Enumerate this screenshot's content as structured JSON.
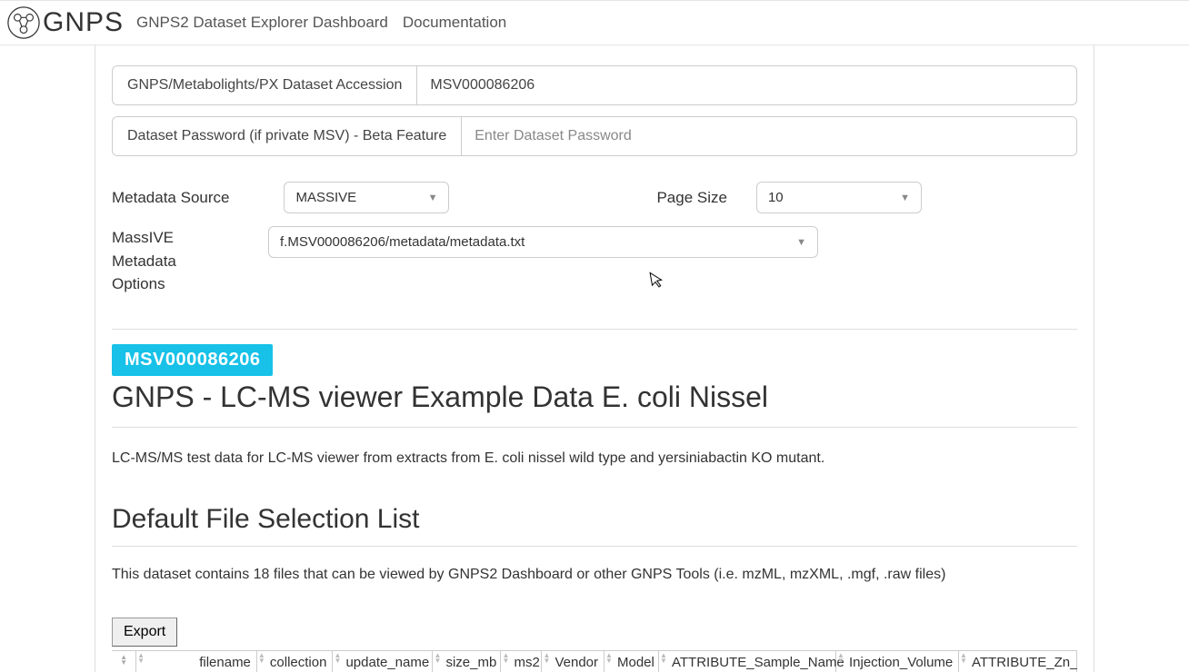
{
  "nav": {
    "logo_text": "GNPS",
    "link1": "GNPS2 Dataset Explorer Dashboard",
    "link2": "Documentation"
  },
  "form": {
    "accession_label": "GNPS/Metabolights/PX Dataset Accession",
    "accession_value": "MSV000086206",
    "password_label": "Dataset Password (if private MSV) - Beta Feature",
    "password_placeholder": "Enter Dataset Password",
    "metadata_source_label": "Metadata Source",
    "metadata_source_value": "MASSIVE",
    "page_size_label": "Page Size",
    "page_size_value": "10",
    "massive_metadata_label": "MassIVE Metadata Options",
    "massive_metadata_value": "f.MSV000086206/metadata/metadata.txt"
  },
  "dataset": {
    "badge": "MSV000086206",
    "title": "GNPS - LC-MS viewer Example Data E. coli Nissel",
    "description": "LC-MS/MS test data for LC-MS viewer from extracts from E. coli nissel wild type and yersiniabactin KO mutant.",
    "section_title": "Default File Selection List",
    "note": "This dataset contains 18 files that can be viewed by GNPS2 Dashboard or other GNPS Tools (i.e. mzML, mzXML, .mgf, .raw files)",
    "export_label": "Export"
  },
  "table": {
    "columns": [
      "filename",
      "collection",
      "update_name",
      "size_mb",
      "ms2",
      "Vendor",
      "Model",
      "ATTRIBUTE_Sample_Name",
      "Injection_Volume",
      "ATTRIBUTE_Zn_b"
    ]
  }
}
